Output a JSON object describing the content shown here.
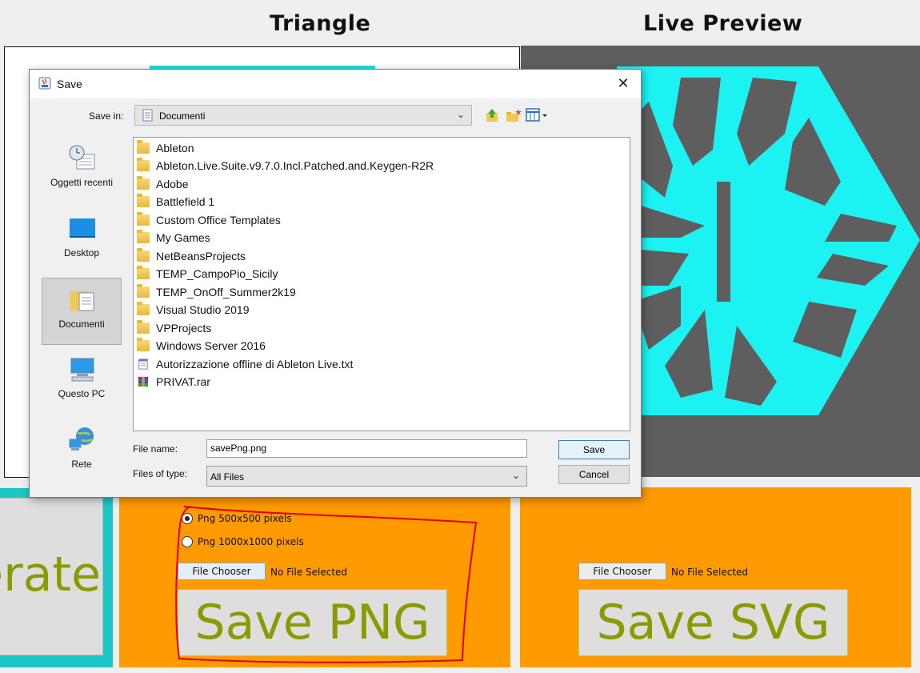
{
  "headings": {
    "triangle": "Triangle",
    "live_preview": "Live Preview"
  },
  "colors": {
    "accent_cyan": "#1cf2f2",
    "preview_bg": "#5e5e5e",
    "orange": "#ff9a00",
    "button_text": "#8a9a00",
    "annotation_red": "#e00000"
  },
  "generate": {
    "label": "erate"
  },
  "png_panel": {
    "radios": [
      {
        "label": "Png 500x500 pixels",
        "selected": true
      },
      {
        "label": "Png 1000x1000 pixels",
        "selected": false
      }
    ],
    "file_chooser_label": "File Chooser",
    "file_status": "No File Selected",
    "save_label": "Save PNG"
  },
  "svg_panel": {
    "file_chooser_label": "File Chooser",
    "file_status": "No File Selected",
    "save_label": "Save SVG"
  },
  "dialog": {
    "title": "Save",
    "save_in_label": "Save in:",
    "save_in_value": "Documenti",
    "places": [
      {
        "label": "Oggetti recenti",
        "icon": "recent-items-icon"
      },
      {
        "label": "Desktop",
        "icon": "desktop-icon"
      },
      {
        "label": "Documenti",
        "icon": "documents-icon",
        "selected": true
      },
      {
        "label": "Questo PC",
        "icon": "computer-icon"
      },
      {
        "label": "Rete",
        "icon": "network-icon"
      }
    ],
    "files": [
      {
        "name": "Ableton",
        "type": "folder"
      },
      {
        "name": "Ableton.Live.Suite.v9.7.0.Incl.Patched.and.Keygen-R2R",
        "type": "folder"
      },
      {
        "name": "Adobe",
        "type": "folder"
      },
      {
        "name": "Battlefield 1",
        "type": "folder"
      },
      {
        "name": "Custom Office Templates",
        "type": "folder"
      },
      {
        "name": "My Games",
        "type": "folder"
      },
      {
        "name": "NetBeansProjects",
        "type": "folder"
      },
      {
        "name": "TEMP_CampoPio_Sicily",
        "type": "folder"
      },
      {
        "name": "TEMP_OnOff_Summer2k19",
        "type": "folder"
      },
      {
        "name": "Visual Studio 2019",
        "type": "folder"
      },
      {
        "name": "VPProjects",
        "type": "folder"
      },
      {
        "name": "Windows Server 2016",
        "type": "folder"
      },
      {
        "name": "Autorizzazione offline di Ableton Live.txt",
        "type": "text"
      },
      {
        "name": "PRIVAT.rar",
        "type": "archive"
      }
    ],
    "file_name_label": "File name:",
    "file_name_value": "savePng.png",
    "files_of_type_label": "Files of type:",
    "files_of_type_value": "All Files",
    "save_button": "Save",
    "cancel_button": "Cancel"
  }
}
